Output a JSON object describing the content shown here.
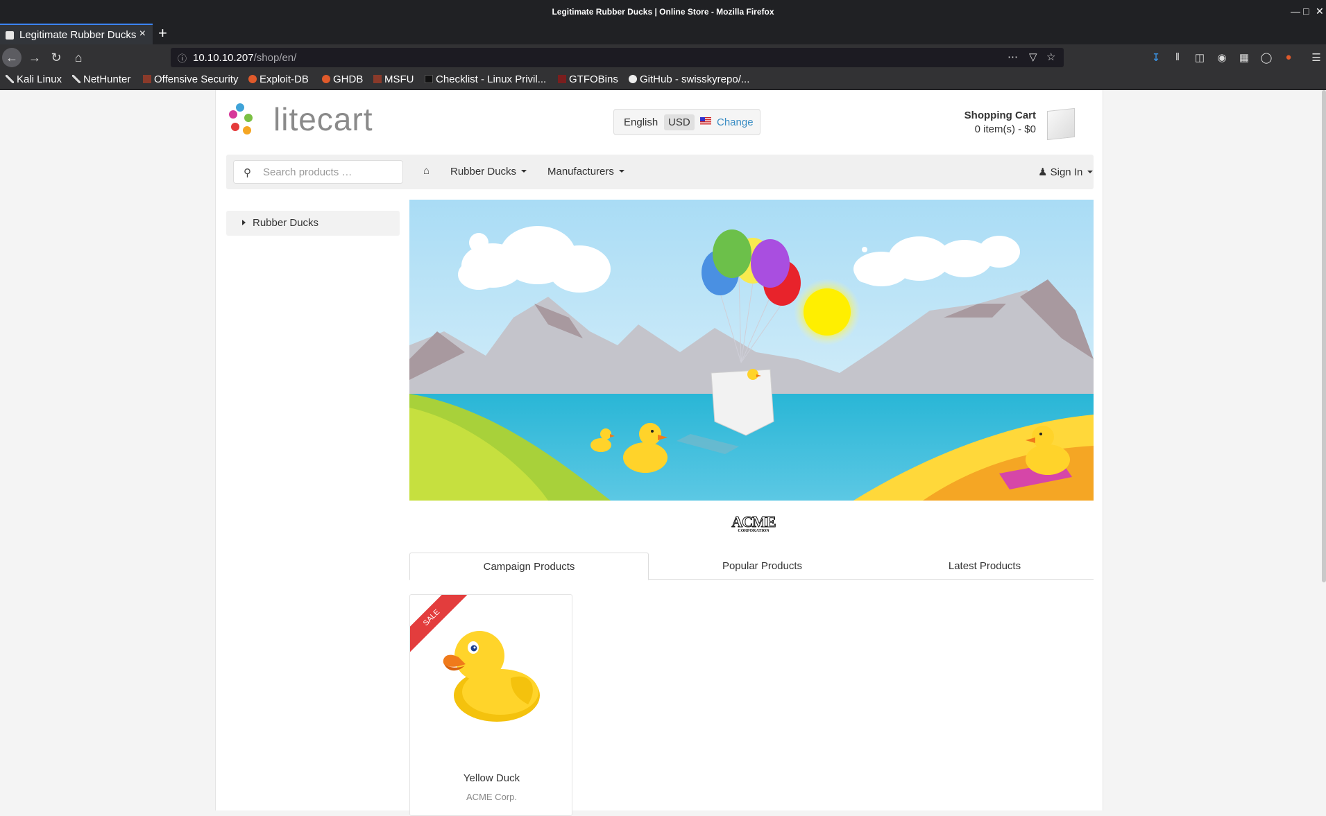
{
  "window": {
    "title": "Legitimate Rubber Ducks | Online Store - Mozilla Firefox",
    "tab_title": "Legitimate Rubber Ducks"
  },
  "browser": {
    "url_host": "10.10.10.207",
    "url_path": "/shop/en/",
    "bookmarks": [
      {
        "label": "Kali Linux",
        "icon": "kali-icon"
      },
      {
        "label": "NetHunter",
        "icon": "kali-icon"
      },
      {
        "label": "Offensive Security",
        "icon": "offsec-icon"
      },
      {
        "label": "Exploit-DB",
        "icon": "exploitdb-icon"
      },
      {
        "label": "GHDB",
        "icon": "exploitdb-icon"
      },
      {
        "label": "MSFU",
        "icon": "offsec-icon"
      },
      {
        "label": "Checklist - Linux Privil...",
        "icon": "page-icon"
      },
      {
        "label": "GTFOBins",
        "icon": "gtfobins-icon"
      },
      {
        "label": "GitHub - swisskyrepo/...",
        "icon": "github-icon"
      }
    ]
  },
  "store": {
    "logo_text": "litecart",
    "region": {
      "language": "English",
      "currency": "USD",
      "change_label": "Change"
    },
    "cart": {
      "title": "Shopping Cart",
      "summary": "0 item(s) - $0"
    },
    "search_placeholder": "Search products …",
    "nav": {
      "categories": "Rubber Ducks",
      "manufacturers": "Manufacturers",
      "sign_in": "Sign In"
    },
    "sidebar": {
      "category": "Rubber Ducks"
    },
    "manufacturer_logo": {
      "main": "ACME",
      "sub": "CORPORATION"
    },
    "product_tabs": [
      "Campaign Products",
      "Popular Products",
      "Latest Products"
    ],
    "products": [
      {
        "name": "Yellow Duck",
        "manufacturer": "ACME Corp.",
        "badge": "SALE"
      }
    ]
  },
  "colors": {
    "link": "#3a8dc4",
    "sale_ribbon": "#e33d3d",
    "titlebar": "#202124",
    "toolbar": "#323234"
  }
}
